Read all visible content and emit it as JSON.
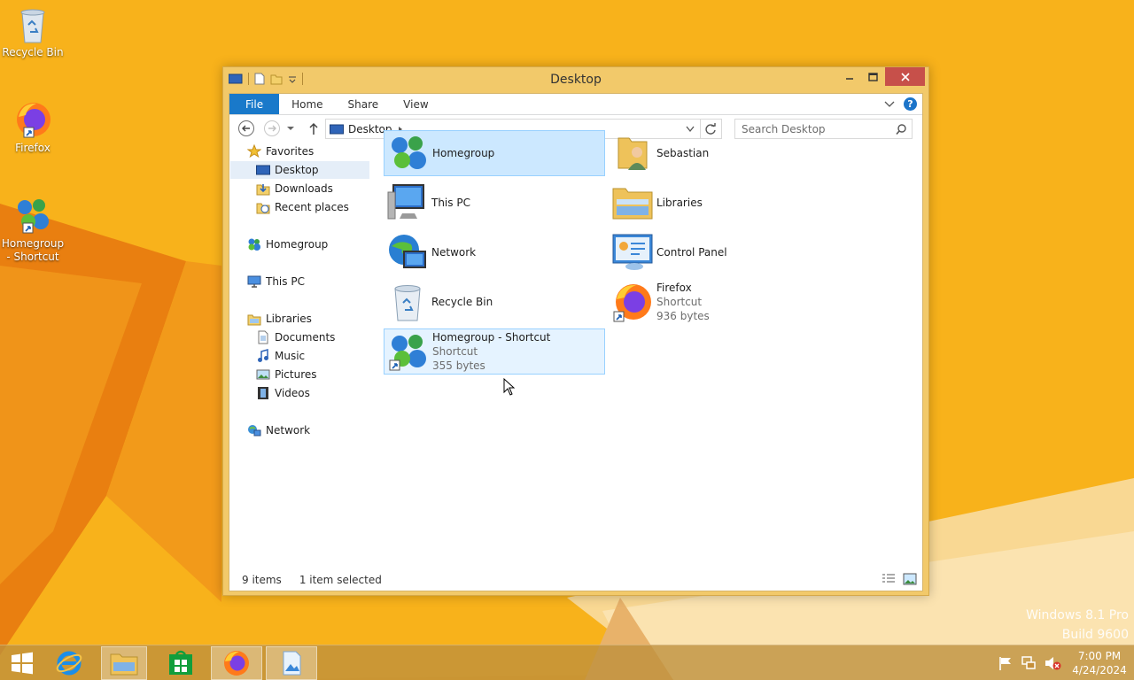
{
  "desktop": {
    "icons": [
      {
        "label": "Recycle Bin",
        "icon": "recycle-bin-icon"
      },
      {
        "label": "Firefox",
        "icon": "firefox-icon"
      },
      {
        "label": "Homegroup - Shortcut",
        "icon": "homegroup-icon"
      }
    ],
    "watermark": {
      "line1": "Windows 8.1 Pro",
      "line2": "Build 9600"
    }
  },
  "window": {
    "title": "Desktop",
    "ribbon_tabs": [
      "File",
      "Home",
      "Share",
      "View"
    ],
    "address": {
      "location": "Desktop"
    },
    "search": {
      "placeholder": "Search Desktop"
    },
    "nav_pane": {
      "favorites": {
        "label": "Favorites",
        "items": [
          "Desktop",
          "Downloads",
          "Recent places"
        ]
      },
      "homegroup": "Homegroup",
      "this_pc": "This PC",
      "libraries": {
        "label": "Libraries",
        "items": [
          "Documents",
          "Music",
          "Pictures",
          "Videos"
        ]
      },
      "network": "Network"
    },
    "items": [
      {
        "name": "Homegroup"
      },
      {
        "name": "Sebastian"
      },
      {
        "name": "This PC"
      },
      {
        "name": "Libraries"
      },
      {
        "name": "Network"
      },
      {
        "name": "Control Panel"
      },
      {
        "name": "Recycle Bin"
      },
      {
        "name": "Firefox",
        "type": "Shortcut",
        "size": "936 bytes"
      },
      {
        "name": "Homegroup - Shortcut",
        "type": "Shortcut",
        "size": "355 bytes"
      }
    ],
    "status": {
      "count": "9 items",
      "selection": "1 item selected"
    }
  },
  "taskbar": {
    "apps": [
      "start-icon",
      "internet-explorer-icon",
      "file-explorer-icon",
      "store-icon",
      "firefox-icon",
      "photos-icon"
    ],
    "clock": {
      "time": "7:00 PM",
      "date": "4/24/2024"
    }
  },
  "colors": {
    "accent": "#1979ca",
    "window_frame": "#f2c96a",
    "selection": "#cce8ff",
    "close_button": "#c7504a"
  }
}
